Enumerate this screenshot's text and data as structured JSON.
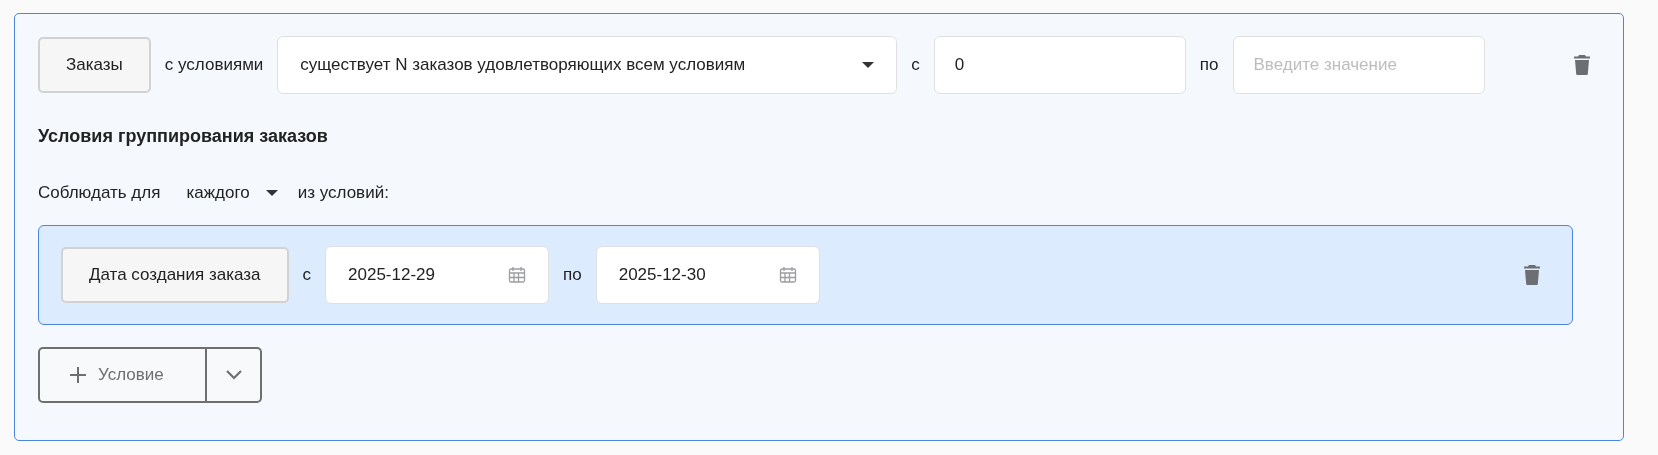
{
  "entity_button": "Заказы",
  "conditions_label": "с условиями",
  "mode_select": {
    "value": "существует N заказов удовлетворяющих всем условиям"
  },
  "from_label": "с",
  "from_field": {
    "value": "0"
  },
  "to_label": "по",
  "to_field": {
    "placeholder": "Введите значение"
  },
  "grouping_heading": "Условия группирования заказов",
  "match": {
    "prefix": "Соблюдать для",
    "value": "каждого",
    "suffix": "из условий:"
  },
  "conditions": [
    {
      "field_button": "Дата создания заказа",
      "from_label": "с",
      "from_date": "2025-12-29",
      "to_label": "по",
      "to_date": "2025-12-30"
    }
  ],
  "add_button": "Условие"
}
